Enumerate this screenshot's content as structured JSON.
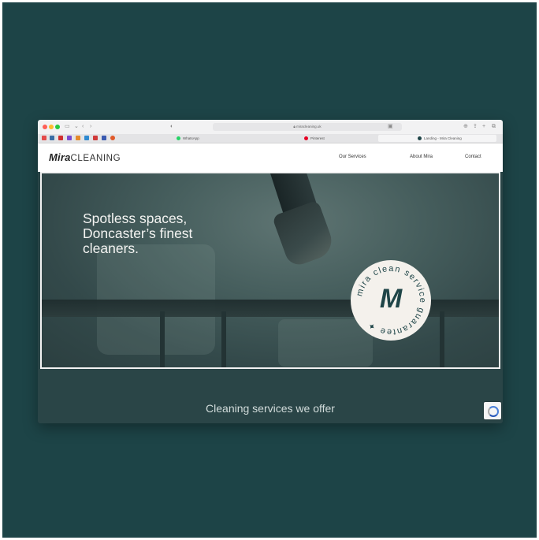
{
  "browser": {
    "url": "miracleaning.uk",
    "tabs": [
      {
        "label": "WhatsApp",
        "color": "#25d366"
      },
      {
        "label": "Pinterest",
        "color": "#e60023"
      },
      {
        "label": "Landing - Mira Cleaning",
        "color": "#1f4548"
      }
    ],
    "favorites_colors": [
      "#e34a4a",
      "#3a6ea5",
      "#d02f2f",
      "#7a4ad0",
      "#e58a2a",
      "#2f8ad0",
      "#d03a3a",
      "#3a5ab0",
      "#e05a2a"
    ]
  },
  "site": {
    "logo_bold": "Mira",
    "logo_light": "CLEANING",
    "nav": {
      "services": "Our Services",
      "about": "About Mira",
      "contact": "Contact"
    },
    "hero": {
      "line1": "Spotless spaces,",
      "line2": "Doncaster’s finest",
      "line3": "cleaners."
    },
    "badge": {
      "letter": "M",
      "ring_text": "mira clean service guarantee ✦"
    },
    "section_title": "Cleaning services we offer"
  },
  "colors": {
    "backdrop": "#1d4447",
    "accent": "#1f4548",
    "badge_bg": "#f4f1ec"
  }
}
